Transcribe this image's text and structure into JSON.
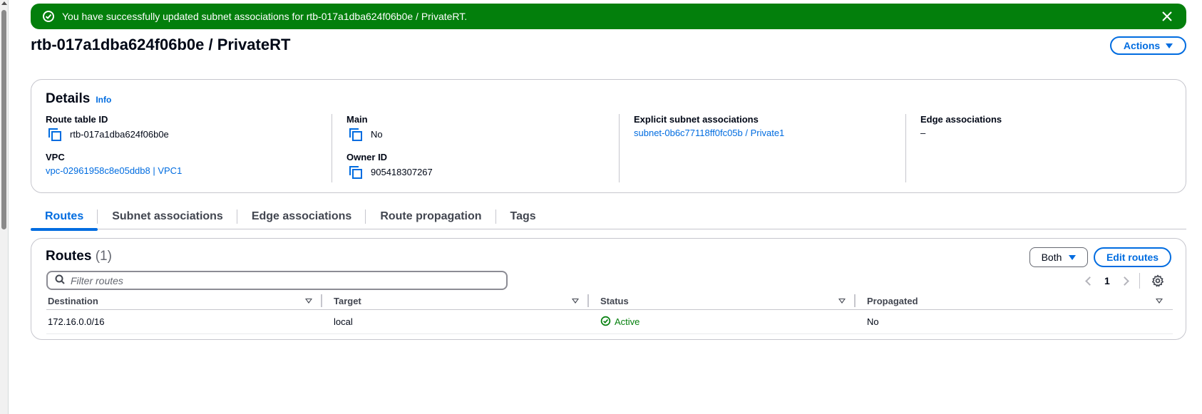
{
  "flash": {
    "message": "You have successfully updated subnet associations for rtb-017a1dba624f06b0e / PrivateRT.",
    "icon": "check-circle-icon",
    "close_icon": "close-icon",
    "color": "#037f0c"
  },
  "header": {
    "title": "rtb-017a1dba624f06b0e / PrivateRT",
    "actions_label": "Actions"
  },
  "details": {
    "title": "Details",
    "info_label": "Info",
    "route_table_id_label": "Route table ID",
    "route_table_id": "rtb-017a1dba624f06b0e",
    "vpc_label": "VPC",
    "vpc_value": "vpc-02961958c8e05ddb8 | VPC1",
    "main_label": "Main",
    "main_value": "No",
    "owner_id_label": "Owner ID",
    "owner_id": "905418307267",
    "explicit_subnet_label": "Explicit subnet associations",
    "explicit_subnet_value": "subnet-0b6c77118ff0fc05b / Private1",
    "edge_label": "Edge associations",
    "edge_value": "–"
  },
  "tabs": [
    {
      "label": "Routes",
      "active": true
    },
    {
      "label": "Subnet associations",
      "active": false
    },
    {
      "label": "Edge associations",
      "active": false
    },
    {
      "label": "Route propagation",
      "active": false
    },
    {
      "label": "Tags",
      "active": false
    }
  ],
  "routes": {
    "title": "Routes",
    "count": "(1)",
    "filter_select_value": "Both",
    "edit_label": "Edit routes",
    "filter_placeholder": "Filter routes",
    "page": "1",
    "columns": [
      "Destination",
      "Target",
      "Status",
      "Propagated"
    ],
    "rows": [
      {
        "destination": "172.16.0.0/16",
        "target": "local",
        "status": "Active",
        "propagated": "No"
      }
    ]
  },
  "colors": {
    "accent": "#006ce0",
    "success": "#037f0c",
    "border": "#c6c6cd"
  }
}
